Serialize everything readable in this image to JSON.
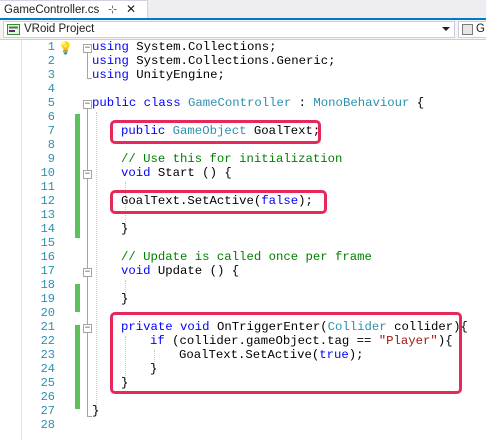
{
  "tab": {
    "title": "GameController.cs",
    "pin_icon": "pin-icon",
    "close_icon": "close-icon"
  },
  "navbar": {
    "project": "VRoid Project",
    "project_icon": "csharp-project-icon",
    "second_combo_text": "G"
  },
  "editor": {
    "line_numbers": [
      "1",
      "2",
      "3",
      "4",
      "5",
      "6",
      "7",
      "8",
      "9",
      "10",
      "11",
      "12",
      "13",
      "14",
      "15",
      "16",
      "17",
      "18",
      "19",
      "20",
      "21",
      "22",
      "23",
      "24",
      "25",
      "26",
      "27",
      "28"
    ],
    "lines": [
      [
        "using System.Collections;"
      ],
      [
        "using System.Collections.Generic;"
      ],
      [
        "using UnityEngine;"
      ],
      [
        ""
      ],
      [
        "public class GameController : MonoBehaviour {"
      ],
      [
        ""
      ],
      [
        "public GameObject GoalText;"
      ],
      [
        ""
      ],
      [
        "// Use this for initialization"
      ],
      [
        "void Start () {"
      ],
      [
        ""
      ],
      [
        "GoalText.SetActive(false);"
      ],
      [
        ""
      ],
      [
        "}"
      ],
      [
        ""
      ],
      [
        "// Update is called once per frame"
      ],
      [
        "void Update () {"
      ],
      [
        ""
      ],
      [
        "}"
      ],
      [
        ""
      ],
      [
        "private void OnTriggerEnter(Collider collider){"
      ],
      [
        "if (collider.gameObject.tag == \"Player\"){"
      ],
      [
        "GoalText.SetActive(true);"
      ],
      [
        "}"
      ],
      [
        "}"
      ],
      [
        ""
      ],
      [
        "}"
      ],
      [
        ""
      ]
    ],
    "tokens": {
      "l1_kw": "using",
      "l1_rest": " System.Collections;",
      "l2_kw": "using",
      "l2_rest": " System.Collections.Generic;",
      "l3_kw": "using",
      "l3_rest": " UnityEngine;",
      "l5_kw1": "public",
      "l5_kw2": "class",
      "l5_ty1": "GameController",
      "l5_colon": " : ",
      "l5_ty2": "MonoBehaviour",
      "l5_brace": " {",
      "l7_kw": "public",
      "l7_ty": "GameObject",
      "l7_rest": " GoalText;",
      "l9_cm": "// Use this for initialization",
      "l10_kw": "void",
      "l10_rest": " Start () {",
      "l12_a": "GoalText.SetActive(",
      "l12_kw": "false",
      "l12_b": ");",
      "l14": "}",
      "l16_cm": "// Update is called once per frame",
      "l17_kw": "void",
      "l17_rest": " Update () {",
      "l19": "}",
      "l21_kw1": "private",
      "l21_kw2": "void",
      "l21_a": " OnTriggerEnter(",
      "l21_ty": "Collider",
      "l21_b": " collider){",
      "l22_kw": "if",
      "l22_a": " (collider.gameObject.tag == ",
      "l22_st": "\"Player\"",
      "l22_b": "){",
      "l23_a": "GoalText.SetActive(",
      "l23_kw": "true",
      "l23_b": ");",
      "l24": "}",
      "l25": "}",
      "l27": "}"
    },
    "lightbulb_icon": "lightbulb-icon"
  },
  "colors": {
    "keyword": "#0000ff",
    "type": "#2b91af",
    "comment": "#008000",
    "string": "#a31515",
    "line_number": "#2b91af",
    "change_bar": "#5cc05c",
    "highlight_box": "#e8285a",
    "tab_accent": "#007acc"
  }
}
